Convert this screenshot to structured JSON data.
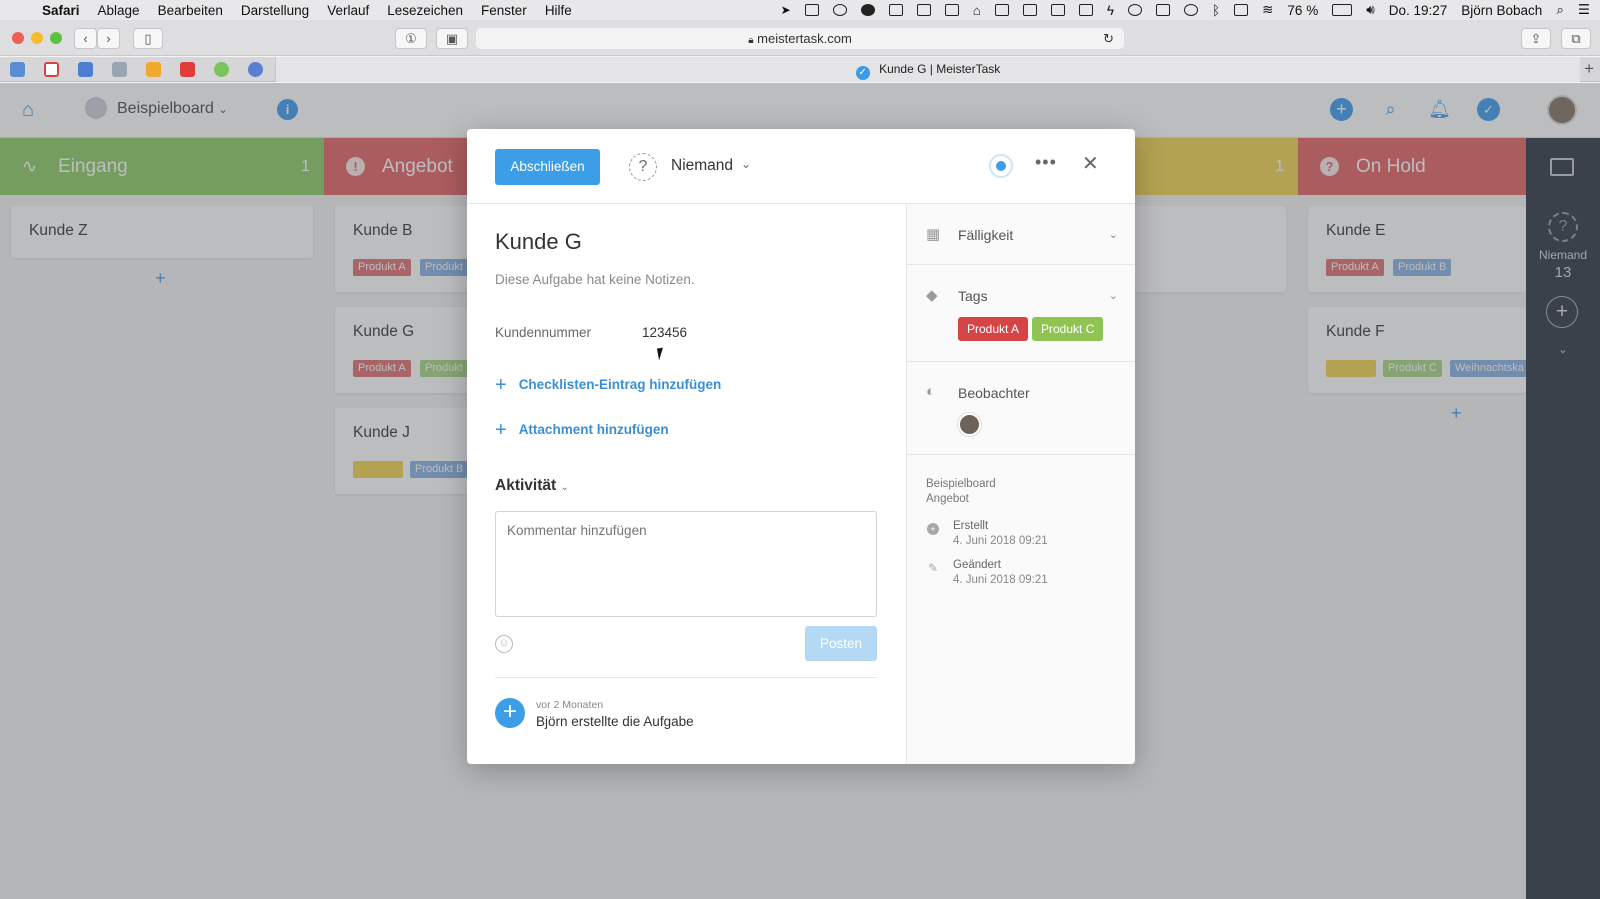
{
  "menubar": {
    "app": "Safari",
    "items": [
      "Ablage",
      "Bearbeiten",
      "Darstellung",
      "Verlauf",
      "Lesezeichen",
      "Fenster",
      "Hilfe"
    ],
    "battery": "76 %",
    "clock": "Do. 19:27",
    "user": "Björn Bobach"
  },
  "safari": {
    "url": "meistertask.com",
    "tab_title": "Kunde G | MeisterTask"
  },
  "app_header": {
    "board_name": "Beispielboard"
  },
  "board": {
    "columns": [
      {
        "title": "Eingang",
        "count": "1",
        "color": "#94cf6e"
      },
      {
        "title": "Angebot",
        "count": "",
        "color": "#e56d6d"
      },
      {
        "title": "",
        "count": "1",
        "color": "#f2d65a"
      },
      {
        "title": "On Hold",
        "count": "",
        "color": "#e56d6d"
      }
    ],
    "cards": {
      "eingang": [
        "Kunde Z"
      ],
      "angebot": [
        "Kunde B",
        "Kunde G",
        "Kunde J"
      ],
      "onhold": [
        "Kunde E",
        "Kunde F"
      ]
    },
    "chips": {
      "produkt_a": "Produkt A",
      "produkt_b": "Produkt B",
      "produkt_c": "Produkt C",
      "weihnacht": "Weihnachtska"
    }
  },
  "right_panel": {
    "label": "Niemand",
    "count": "13"
  },
  "modal": {
    "complete_button": "Abschließen",
    "assignee": "Niemand",
    "task_title": "Kunde G",
    "notes": "Diese Aufgabe hat keine Notizen.",
    "custom_field_label": "Kundennummer",
    "custom_field_value": "123456",
    "add_checklist": "Checklisten-Eintrag hinzufügen",
    "add_attachment": "Attachment hinzufügen",
    "activity_heading": "Aktivität",
    "comment_placeholder": "Kommentar hinzufügen",
    "post_button": "Posten",
    "activity_time": "vor 2 Monaten",
    "activity_text": "Björn erstellte die Aufgabe"
  },
  "sidebar": {
    "due_label": "Fälligkeit",
    "tags_label": "Tags",
    "tags": [
      {
        "label": "Produkt A",
        "color": "#d64545"
      },
      {
        "label": "Produkt C",
        "color": "#8fc454"
      }
    ],
    "watchers_label": "Beobachter",
    "board": "Beispielboard",
    "column": "Angebot",
    "created_label": "Erstellt",
    "created_date": "4. Juni 2018 09:21",
    "changed_label": "Geändert",
    "changed_date": "4. Juni 2018 09:21"
  }
}
